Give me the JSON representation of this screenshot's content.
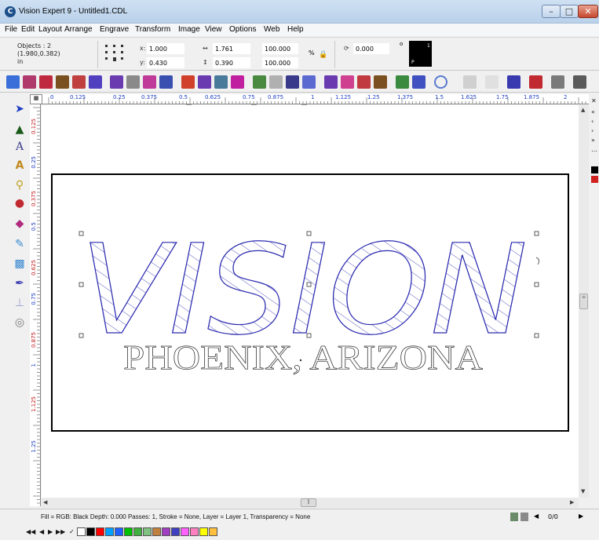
{
  "window": {
    "title": "Vision Expert 9  - Untitled1.CDL",
    "app_icon": "C",
    "minimize_icon": "minimize-icon",
    "maximize_icon": "maximize-icon",
    "close_icon": "close-icon"
  },
  "menu": [
    "File",
    "Edit",
    "Layout",
    "Arrange",
    "Engrave",
    "Transform",
    "Image",
    "View",
    "Options",
    "Web",
    "Help"
  ],
  "props": {
    "objects_label": "Objects : 2",
    "coords": "(1.980,0.382)",
    "units": "in",
    "x_label": "x:",
    "x_value": "1.000",
    "y_label": "y:",
    "y_value": "0.430",
    "width_value": "1.761",
    "height_value": "0.390",
    "scale_w": "100.000",
    "scale_h": "100.000",
    "percent": "%",
    "rotation_value": "0.000",
    "degree": "o",
    "color_p": "P",
    "color_num": "1"
  },
  "ruler": {
    "h_labels": [
      "0",
      "0.125",
      "0.25",
      "0.375",
      "0.5",
      "0.625",
      "0.75",
      "0.875",
      "1",
      "1.125",
      "1.25",
      "1.375",
      "1.5",
      "1.625",
      "1.75",
      "1.875",
      "2"
    ],
    "v_labels": [
      "0.125",
      "0.25",
      "0.375",
      "0.5",
      "0.625",
      "0.75",
      "0.875",
      "1",
      "1.125",
      "1.25"
    ]
  },
  "sign": {
    "headline": "VISION",
    "subline": "PHOENIX, ARIZONA"
  },
  "status": {
    "text": "Fill = RGB: Black Depth: 0.000 Passes: 1, Stroke = None, Layer = Layer 1, Transparency = None",
    "page_count": "0/0"
  },
  "palette": {
    "colors": [
      "#ffffff",
      "#000000",
      "#ff0000",
      "#00a0ff",
      "#2060ff",
      "#00c000",
      "#40b040",
      "#80c080",
      "#c08040",
      "#a040c0",
      "#4040c0",
      "#ff60ff",
      "#ff80c0",
      "#ffff00",
      "#ffc040"
    ]
  },
  "toolbar_icons": [
    "new-icon",
    "open-icon",
    "save-icon",
    "import-icon",
    "print-icon",
    "engrave-icon",
    "cut-icon",
    "undo-icon",
    "redo-icon",
    "group-icon",
    "ungroup-icon",
    "align-icon",
    "layer-icon",
    "layout-icon",
    "node-icon",
    "weld-icon",
    "text-icon",
    "image-icon",
    "color-icon",
    "circle-icon",
    "text-fit-icon",
    "text-effect-icon",
    "cancel-icon",
    "tool-icon"
  ],
  "left_tools": [
    "pointer-icon",
    "node-edit-icon",
    "text-tool-icon",
    "text-box-icon",
    "zoom-icon",
    "fill-icon",
    "shape-icon",
    "pencil-icon",
    "eraser-icon",
    "pen-icon",
    "dimension-icon",
    "paint-icon"
  ]
}
